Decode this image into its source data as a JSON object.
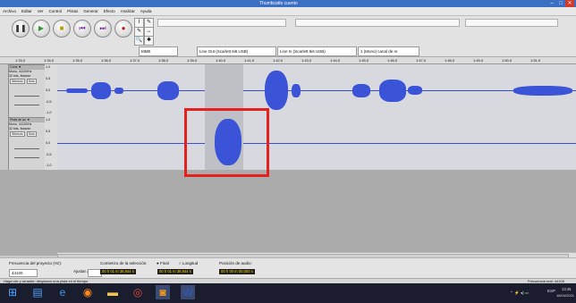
{
  "window": {
    "title": "Thumbcatto cuento",
    "controls": [
      "–",
      "□",
      "✕"
    ]
  },
  "menu": [
    "Archivo",
    "Editar",
    "Ver",
    "Control",
    "Pistas",
    "Generar",
    "Efecto",
    "Analizar",
    "Ayuda"
  ],
  "transport": [
    {
      "name": "pause-button",
      "icon": "pause-icon",
      "glyph": "❚❚"
    },
    {
      "name": "play-button",
      "icon": "play-icon",
      "glyph": "▶"
    },
    {
      "name": "stop-button",
      "icon": "stop-icon",
      "glyph": "■"
    },
    {
      "name": "skip-start-button",
      "icon": "skip-start-icon",
      "glyph": "⏮"
    },
    {
      "name": "skip-end-button",
      "icon": "skip-end-icon",
      "glyph": "⏭"
    },
    {
      "name": "record-button",
      "icon": "record-icon",
      "glyph": "●"
    }
  ],
  "tools": [
    "I",
    "✎",
    "↔",
    "🔍",
    "✱",
    "↔"
  ],
  "devices": {
    "host": "MME",
    "playback": "Line Out (Scarlett 6i6 USB)",
    "recording": "Line In (Scarlett 6i6 USB)",
    "channels": "1 (Mono) canal de re"
  },
  "ruler_ticks": [
    "1:33,0",
    "1:34,0",
    "1:35,0",
    "1:36,0",
    "1:37,0",
    "1:38,0",
    "1:39,0",
    "1:40,0",
    "1:41,0",
    "1:42,0",
    "1:43,0",
    "1:44,0",
    "1:45,0",
    "1:46,0",
    "1:47,0",
    "1:48,0",
    "1:49,0",
    "1:50,0",
    "1:51,0"
  ],
  "tracks": [
    {
      "name": "Cons",
      "info": "Mono, 44100Hz",
      "format": "32 bits, flotante",
      "mute": "Silencio",
      "solo": "Solo",
      "scale": [
        "1,0",
        "0,5",
        "0,0",
        "-0,5",
        "-1,0"
      ]
    },
    {
      "name": "Pista de au",
      "info": "Mono, 44100Hz",
      "format": "32 bits, flotante",
      "mute": "Silencio",
      "solo": "Solo",
      "scale": [
        "1,0",
        "0,5",
        "0,0",
        "-0,5",
        "-1,0"
      ]
    }
  ],
  "selection_toolbar": {
    "rate_label": "Frecuencia del proyecto (Hz):",
    "rate_value": "44100",
    "snap_label": "Ajustar a",
    "snap_value": "",
    "sel_label": "Comienzo de la selección:",
    "end_option": "Final",
    "length_option": "Longitud",
    "pos_label": "Posición de audio:",
    "start_time": "00 h 01 m 38,944 s",
    "end_time": "00 h 01 m 38,944 s",
    "audio_pos": "00 h 00 m 00,000 s"
  },
  "status": {
    "left": "Haga clic y arrastre: desplazar una pista en el tiempo",
    "right": "Frecuencia real: 44100"
  },
  "taskbar": {
    "time": "13:45",
    "date": "18/04/2021",
    "lang": "ESP",
    "apps": [
      "windows-icon",
      "explorer-icon",
      "ie-icon",
      "firefox-icon",
      "files-icon",
      "chrome-icon",
      "audacity-icon",
      "word-icon"
    ]
  }
}
